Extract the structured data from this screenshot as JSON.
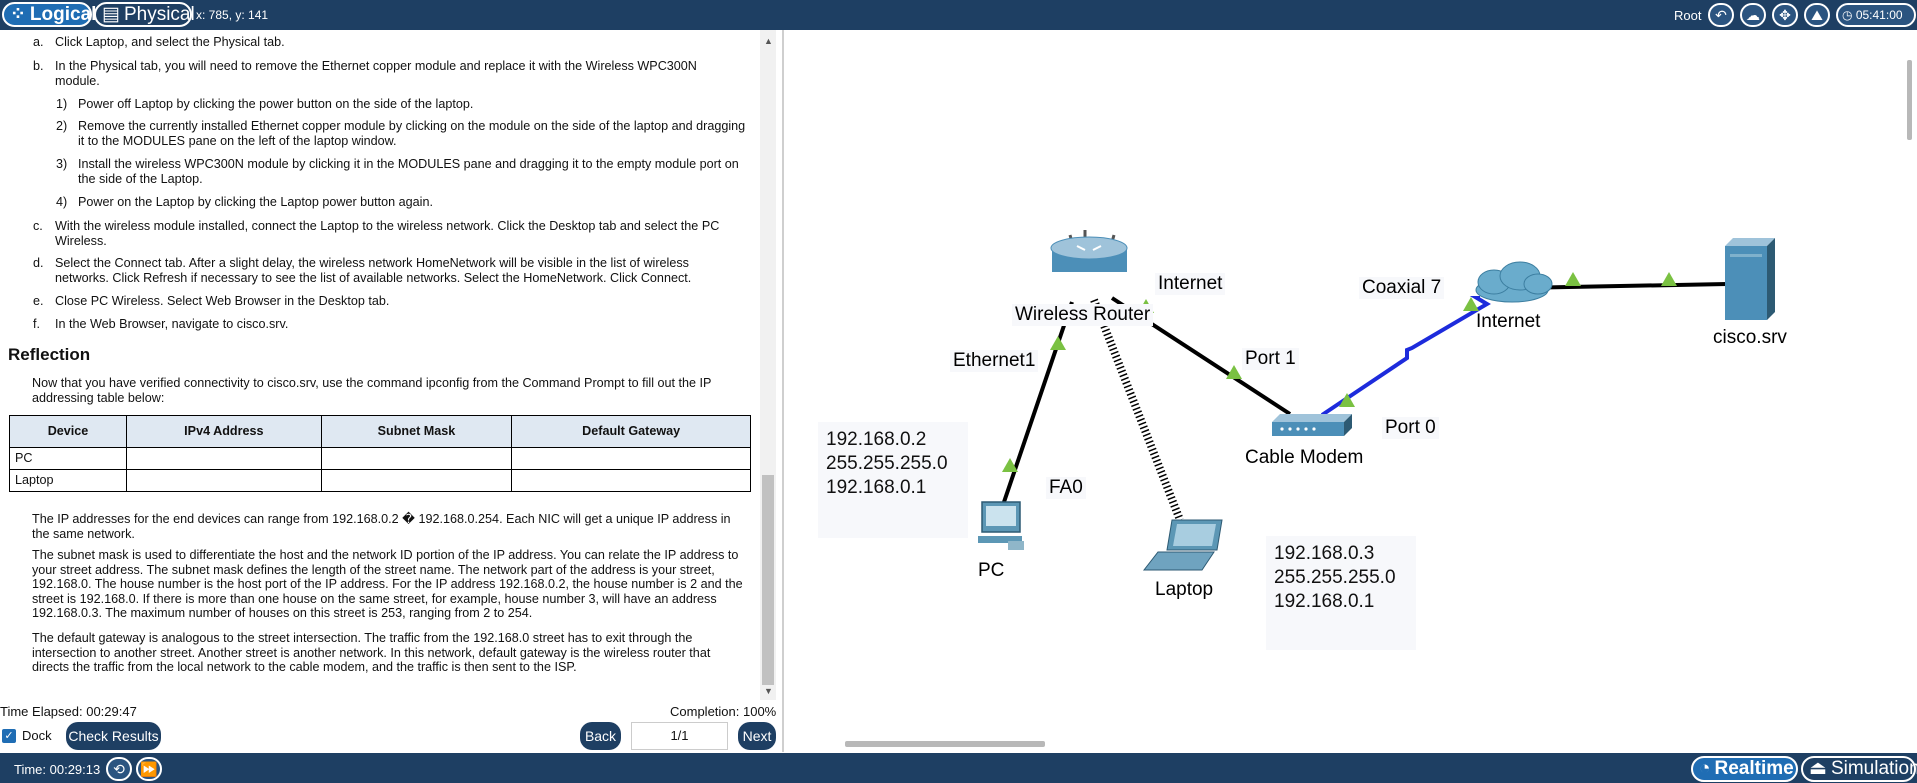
{
  "topbar": {
    "logical_label": "Logical",
    "physical_label": "Physical",
    "coords": "x: 785, y: 141",
    "root_label": "Root",
    "clock": "05:41:00",
    "icons": [
      "back-icon",
      "cloud-icon",
      "move-icon",
      "mountain-icon",
      "viewport-icon"
    ]
  },
  "instructions": {
    "steps": [
      {
        "letter": "a.",
        "text": "Click Laptop, and select the Physical tab."
      },
      {
        "letter": "b.",
        "text": "In the Physical tab, you will need to remove the Ethernet copper module and replace it with the Wireless WPC300N module."
      },
      {
        "letter": "c.",
        "text": "With the wireless module installed, connect the Laptop to the wireless network. Click the Desktop tab and select the PC Wireless."
      },
      {
        "letter": "d.",
        "text": "Select the Connect tab. After a slight delay, the wireless network HomeNetwork will be visible in the list of wireless networks. Click Refresh if necessary to see the list of available networks. Select the HomeNetwork. Click Connect."
      },
      {
        "letter": "e.",
        "text": "Close PC Wireless. Select Web Browser in the Desktop tab."
      },
      {
        "letter": "f.",
        "text": "In the Web Browser, navigate to cisco.srv."
      }
    ],
    "substeps": [
      {
        "num": "1)",
        "text": "Power off Laptop by clicking the power button on the side of the laptop."
      },
      {
        "num": "2)",
        "text": "Remove the currently installed Ethernet copper module by clicking on the module on the side of the laptop and dragging it to the MODULES pane on the left of the laptop window."
      },
      {
        "num": "3)",
        "text": "Install the wireless WPC300N module by clicking it in the MODULES pane and dragging it to the empty module port on the side of the Laptop."
      },
      {
        "num": "4)",
        "text": "Power on the Laptop by clicking the Laptop power button again."
      }
    ],
    "reflection_heading": "Reflection",
    "reflection_intro": "Now that you have verified connectivity to cisco.srv, use the command ipconfig from the Command Prompt to fill out the IP addressing table below:",
    "table": {
      "headers": [
        "Device",
        "IPv4 Address",
        "Subnet Mask",
        "Default Gateway"
      ],
      "rows": [
        [
          "PC",
          "",
          "",
          ""
        ],
        [
          "Laptop",
          "",
          "",
          ""
        ]
      ]
    },
    "para1": "The IP addresses for the end devices can range from 192.168.0.2 � 192.168.0.254. Each NIC will get a unique IP address in the same network.",
    "para2": "The subnet mask is used to differentiate the host and the network ID portion of the IP address. You can relate the IP address to your street address. The subnet mask defines the length of the street name. The network part of the address is your street, 192.168.0. The house number is the host port of the IP address. For the IP address 192.168.0.2, the house number is 2 and the street is 192.168.0. If there is more than one house on the same street, for example, house number 3, will have an address 192.168.0.3. The maximum number of houses on this street is 253, ranging from 2 to 254.",
    "para3": "The default gateway is analogous to the street intersection. The traffic from the 192.168.0 street has to exit through the intersection to another street. Another street is another network. In this network, default gateway is the wireless router that directs the traffic from the local network to the cable modem, and the traffic is then sent to the ISP."
  },
  "footer": {
    "time_elapsed": "Time Elapsed: 00:29:47",
    "completion": "Completion: 100%",
    "dock_label": "Dock",
    "check_results": "Check Results",
    "back": "Back",
    "page": "1/1",
    "next": "Next"
  },
  "topology": {
    "labels": {
      "wireless_router": "Wireless Router",
      "internet_port": "Internet",
      "ethernet1": "Ethernet1",
      "port1": "Port 1",
      "port0": "Port 0",
      "coaxial7": "Coaxial 7",
      "internet_cloud": "Internet",
      "cisco_srv": "cisco.srv",
      "cable_modem": "Cable Modem",
      "fa0": "FA0",
      "pc": "PC",
      "laptop": "Laptop"
    },
    "pc_ip": [
      "192.168.0.2",
      "255.255.255.0",
      "192.168.0.1"
    ],
    "laptop_ip": [
      "192.168.0.3",
      "255.255.255.0",
      "192.168.0.1"
    ]
  },
  "bottombar": {
    "time": "Time: 00:29:13",
    "realtime": "Realtime",
    "simulation": "Simulation"
  },
  "colors": {
    "bar": "#1e3f63",
    "accent": "#1f6db4",
    "link_up": "#7ac142",
    "coax": "#1d2bdc"
  }
}
